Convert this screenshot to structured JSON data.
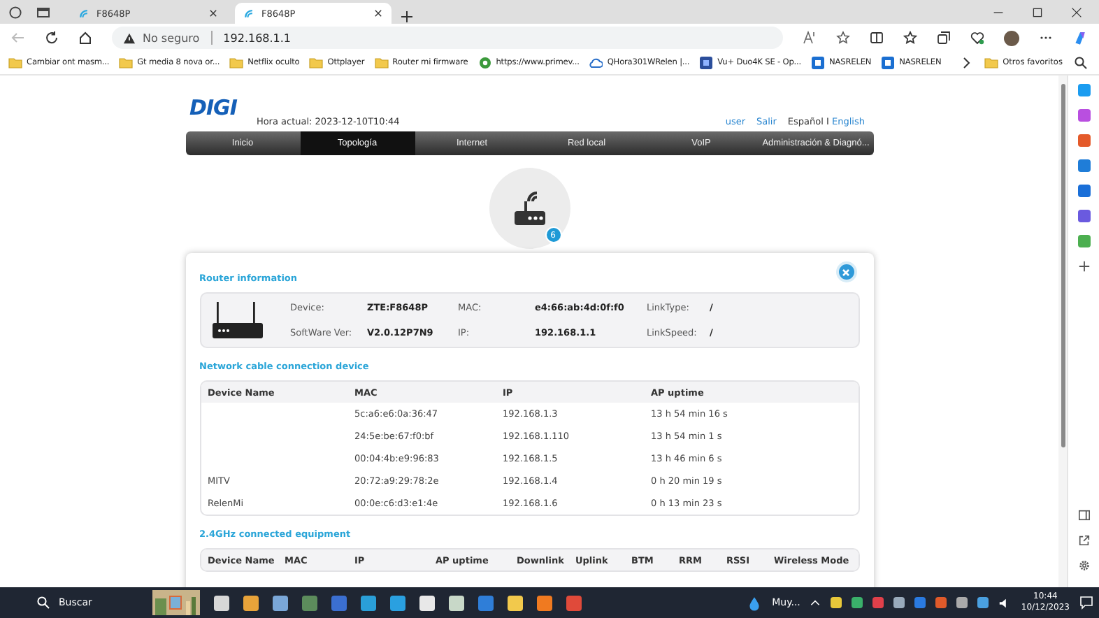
{
  "browser": {
    "tabs": [
      {
        "title": "F8648P",
        "selected": false
      },
      {
        "title": "F8648P",
        "selected": true
      }
    ],
    "address": {
      "security": "No seguro",
      "url": "192.168.1.1"
    },
    "bookmarks": [
      {
        "label": "Cambiar ont masm...",
        "kind": "folder"
      },
      {
        "label": "Gt media 8 nova or...",
        "kind": "folder"
      },
      {
        "label": "Netflix oculto",
        "kind": "folder"
      },
      {
        "label": "Ottplayer",
        "kind": "folder"
      },
      {
        "label": "Router mi firmware",
        "kind": "folder"
      },
      {
        "label": "https://www.primev...",
        "kind": "site"
      },
      {
        "label": "QHora301WRelen |...",
        "kind": "cloud"
      },
      {
        "label": "Vu+ Duo4K SE - Op...",
        "kind": "app"
      },
      {
        "label": "NASRELEN",
        "kind": "nas"
      },
      {
        "label": "NASRELEN",
        "kind": "nas"
      }
    ],
    "other_bookmarks": "Otros favoritos"
  },
  "page": {
    "logo": "DIGI",
    "time": "Hora actual: 2023-12-10T10:44",
    "user_links": [
      "user",
      "Salir"
    ],
    "languages": [
      {
        "label": "Español",
        "selected": true
      },
      {
        "label": "English",
        "selected": false
      }
    ],
    "language_separator": "I",
    "nav": [
      {
        "label": "Inicio",
        "selected": false
      },
      {
        "label": "Topología",
        "selected": true
      },
      {
        "label": "Internet",
        "selected": false
      },
      {
        "label": "Red local",
        "selected": false
      },
      {
        "label": "VoIP",
        "selected": false
      },
      {
        "label": "Administración & Diagnó...",
        "selected": false
      }
    ],
    "device_count": "6",
    "router_info": {
      "title": "Router information",
      "fields": [
        {
          "label": "Device:",
          "value": "ZTE:F8648P"
        },
        {
          "label": "MAC:",
          "value": "e4:66:ab:4d:0f:f0"
        },
        {
          "label": "LinkType:",
          "value": "/"
        },
        {
          "label": "SoftWare Ver:",
          "value": "V2.0.12P7N9"
        },
        {
          "label": "IP:",
          "value": "192.168.1.1"
        },
        {
          "label": "LinkSpeed:",
          "value": "/"
        }
      ]
    },
    "cable_devices": {
      "title": "Network cable connection device",
      "columns": [
        "Device Name",
        "MAC",
        "IP",
        "AP uptime"
      ],
      "rows": [
        [
          "",
          "5c:a6:e6:0a:36:47",
          "192.168.1.3",
          "13 h 54 min 16 s"
        ],
        [
          "",
          "24:5e:be:67:f0:bf",
          "192.168.1.110",
          "13 h 54 min 1 s"
        ],
        [
          "",
          "00:04:4b:e9:96:83",
          "192.168.1.5",
          "13 h 46 min 6 s"
        ],
        [
          "MITV",
          "20:72:a9:29:78:2e",
          "192.168.1.4",
          "0 h 20 min 19 s"
        ],
        [
          "RelenMi",
          "00:0e:c6:d3:e1:4e",
          "192.168.1.6",
          "0 h 13 min 23 s"
        ]
      ]
    },
    "wifi_24": {
      "title": "2.4GHz connected equipment",
      "columns": [
        "Device Name",
        "MAC",
        "IP",
        "AP uptime",
        "Downlink",
        "Uplink",
        "BTM",
        "RRM",
        "RSSI",
        "Wireless Mode"
      ]
    }
  },
  "taskbar": {
    "search": {
      "placeholder": "Buscar"
    },
    "weather": "Muy...",
    "time": "10:44",
    "date": "10/12/2023"
  }
}
